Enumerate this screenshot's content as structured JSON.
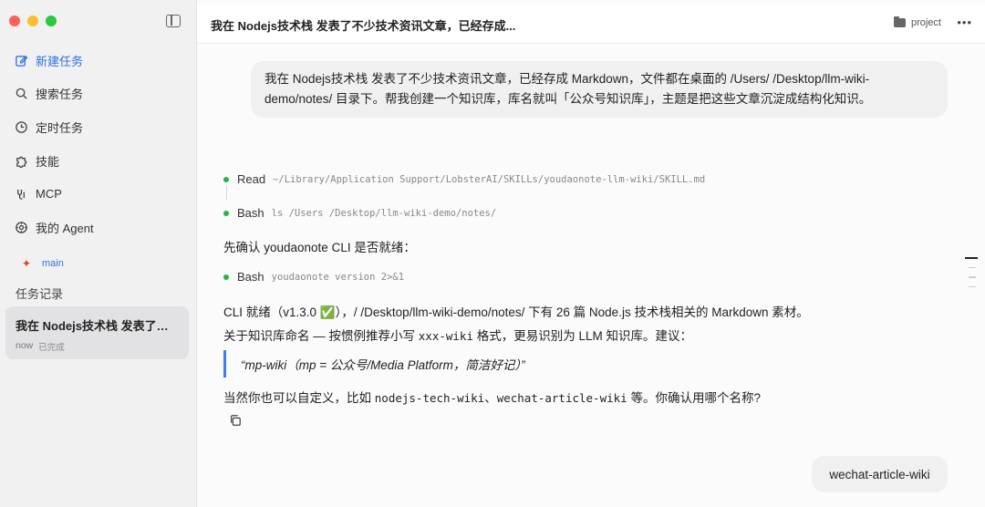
{
  "sidebar": {
    "items": [
      {
        "label": "新建任务",
        "icon": "edit-icon"
      },
      {
        "label": "搜索任务",
        "icon": "search-icon"
      },
      {
        "label": "定时任务",
        "icon": "clock-icon"
      },
      {
        "label": "技能",
        "icon": "puzzle-icon"
      },
      {
        "label": "MCP",
        "icon": "plug-icon"
      },
      {
        "label": "我的 Agent",
        "icon": "agent-icon"
      }
    ],
    "workspace": "main",
    "section_title": "任务记录",
    "task": {
      "title": "我在 Nodejs技术栈 发表了不少技术资讯文章，已经存成...",
      "time": "now",
      "status": "已完成"
    }
  },
  "topbar": {
    "title": "我在 Nodejs技术栈 发表了不少技术资讯文章，已经存成...",
    "project": "project"
  },
  "conversation": {
    "user_message": "我在 Nodejs技术栈 发表了不少技术资讯文章，已经存成 Markdown，文件都在桌面的 /Users/       /Desktop/llm-wiki-demo/notes/ 目录下。帮我创建一个知识库，库名就叫「公众号知识库」，主题是把这些文章沉淀成结构化知识。",
    "tool1": {
      "name": "Read",
      "arg": "~/Library/Application Support/LobsterAI/SKILLs/youdaonote-llm-wiki/SKILL.md"
    },
    "tool2": {
      "name": "Bash",
      "arg": "ls /Users      /Desktop/llm-wiki-demo/notes/"
    },
    "para1": "先确认 youdaonote CLI 是否就绪：",
    "tool3": {
      "name": "Bash",
      "arg": "youdaonote version 2>&1"
    },
    "para2": "CLI 就绪（v1.3.0 ✅），/            /Desktop/llm-wiki-demo/notes/ 下有 26 篇 Node.js 技术栈相关的 Markdown 素材。",
    "para3_a": "关于知识库命名 — 按惯例推荐小写",
    "para3_code": "xxx-wiki",
    "para3_b": "格式，更易识别为 LLM 知识库。建议：",
    "quote": "“mp-wiki（mp = 公众号/Media Platform，简洁好记）”",
    "para4_a": "当然你也可以自定义，比如",
    "para4_code1": "nodejs-tech-wiki",
    "para4_sep": "、",
    "para4_code2": "wechat-article-wiki",
    "para4_b": "等。你确认用哪个名称?",
    "reply": "wechat-article-wiki"
  },
  "colors": {
    "accent": "#2f6fe0",
    "tool_dot": "#27b34a",
    "quote_bar": "#3d7cf2"
  }
}
